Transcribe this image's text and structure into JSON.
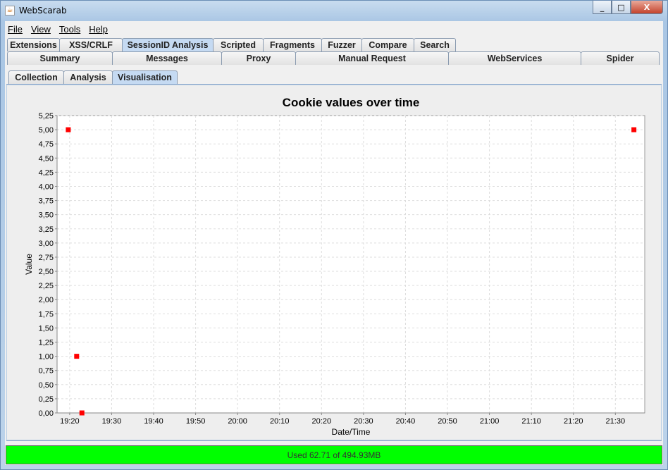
{
  "window": {
    "title": "WebScarab",
    "minimize": "_",
    "maximize": "□",
    "close": "X"
  },
  "menu": [
    "File",
    "View",
    "Tools",
    "Help"
  ],
  "tabs_row1": [
    "Extensions",
    "XSS/CRLF",
    "SessionID Analysis",
    "Scripted",
    "Fragments",
    "Fuzzer",
    "Compare",
    "Search"
  ],
  "tabs_row1_selected": "SessionID Analysis",
  "tabs_row2": [
    "Summary",
    "Messages",
    "Proxy",
    "Manual Request",
    "WebServices",
    "Spider"
  ],
  "tabs_row3": [
    "Collection",
    "Analysis",
    "Visualisation"
  ],
  "tabs_row3_selected": "Visualisation",
  "status": "Used 62.71 of 494.93MB",
  "status_color": "#00ff00",
  "chart_data": {
    "type": "scatter",
    "title": "Cookie values over time",
    "xlabel": "Date/Time",
    "ylabel": "Value",
    "xlim": [
      "19:17",
      "21:37"
    ],
    "ylim": [
      0,
      5.25
    ],
    "x_ticks": [
      "19:20",
      "19:30",
      "19:40",
      "19:50",
      "20:00",
      "20:10",
      "20:20",
      "20:30",
      "20:40",
      "20:50",
      "21:00",
      "21:10",
      "21:20",
      "21:30"
    ],
    "y_ticks": [
      "0,00",
      "0,25",
      "0,50",
      "0,75",
      "1,00",
      "1,25",
      "1,50",
      "1,75",
      "2,00",
      "2,25",
      "2,50",
      "2,75",
      "3,00",
      "3,25",
      "3,50",
      "3,75",
      "4,00",
      "4,25",
      "4,50",
      "4,75",
      "5,00",
      "5,25"
    ],
    "grid": true,
    "marker_color": "#ff0000",
    "points": [
      {
        "x": "19:19:40",
        "y": 5
      },
      {
        "x": "19:21:40",
        "y": 1
      },
      {
        "x": "19:22:55",
        "y": 0
      },
      {
        "x": "21:34:25",
        "y": 5
      }
    ]
  }
}
